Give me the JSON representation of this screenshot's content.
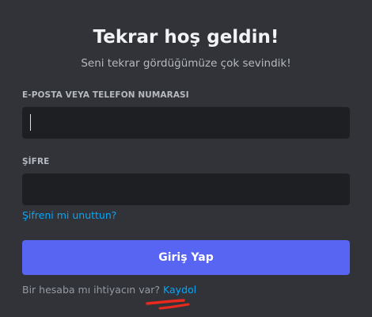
{
  "login": {
    "title": "Tekrar hoş geldin!",
    "subtitle": "Seni tekrar gördüğümüze çok sevindik!",
    "email_label": "E-POSTA VEYA TELEFON NUMARASI",
    "email_value": "",
    "password_label": "ŞİFRE",
    "password_value": "",
    "forgot_password": "Şifreni mi unuttun?",
    "submit_label": "Giriş Yap",
    "register_prompt": "Bir hesaba mı ihtiyacın var?",
    "register_link": "Kaydol"
  },
  "colors": {
    "background": "#313338",
    "input_background": "#1e1f22",
    "accent": "#5865f2",
    "link": "#00a8fc",
    "annotation": "#e8291c"
  }
}
